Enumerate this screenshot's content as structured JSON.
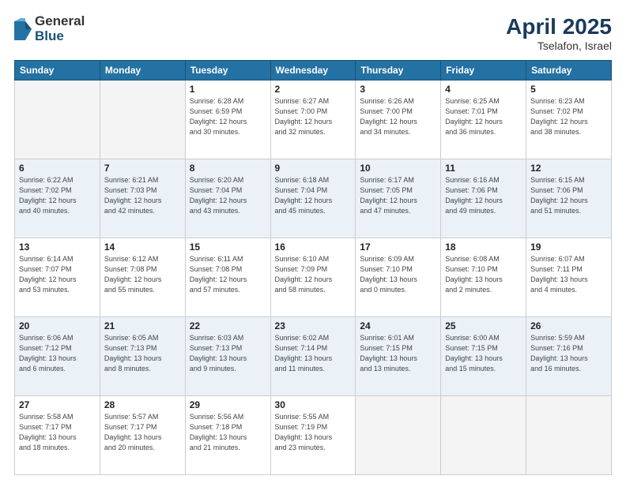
{
  "logo": {
    "general": "General",
    "blue": "Blue"
  },
  "header": {
    "month": "April 2025",
    "location": "Tselafon, Israel"
  },
  "days_of_week": [
    "Sunday",
    "Monday",
    "Tuesday",
    "Wednesday",
    "Thursday",
    "Friday",
    "Saturday"
  ],
  "weeks": [
    [
      {
        "day": "",
        "info": ""
      },
      {
        "day": "",
        "info": ""
      },
      {
        "day": "1",
        "info": "Sunrise: 6:28 AM\nSunset: 6:59 PM\nDaylight: 12 hours\nand 30 minutes."
      },
      {
        "day": "2",
        "info": "Sunrise: 6:27 AM\nSunset: 7:00 PM\nDaylight: 12 hours\nand 32 minutes."
      },
      {
        "day": "3",
        "info": "Sunrise: 6:26 AM\nSunset: 7:00 PM\nDaylight: 12 hours\nand 34 minutes."
      },
      {
        "day": "4",
        "info": "Sunrise: 6:25 AM\nSunset: 7:01 PM\nDaylight: 12 hours\nand 36 minutes."
      },
      {
        "day": "5",
        "info": "Sunrise: 6:23 AM\nSunset: 7:02 PM\nDaylight: 12 hours\nand 38 minutes."
      }
    ],
    [
      {
        "day": "6",
        "info": "Sunrise: 6:22 AM\nSunset: 7:02 PM\nDaylight: 12 hours\nand 40 minutes."
      },
      {
        "day": "7",
        "info": "Sunrise: 6:21 AM\nSunset: 7:03 PM\nDaylight: 12 hours\nand 42 minutes."
      },
      {
        "day": "8",
        "info": "Sunrise: 6:20 AM\nSunset: 7:04 PM\nDaylight: 12 hours\nand 43 minutes."
      },
      {
        "day": "9",
        "info": "Sunrise: 6:18 AM\nSunset: 7:04 PM\nDaylight: 12 hours\nand 45 minutes."
      },
      {
        "day": "10",
        "info": "Sunrise: 6:17 AM\nSunset: 7:05 PM\nDaylight: 12 hours\nand 47 minutes."
      },
      {
        "day": "11",
        "info": "Sunrise: 6:16 AM\nSunset: 7:06 PM\nDaylight: 12 hours\nand 49 minutes."
      },
      {
        "day": "12",
        "info": "Sunrise: 6:15 AM\nSunset: 7:06 PM\nDaylight: 12 hours\nand 51 minutes."
      }
    ],
    [
      {
        "day": "13",
        "info": "Sunrise: 6:14 AM\nSunset: 7:07 PM\nDaylight: 12 hours\nand 53 minutes."
      },
      {
        "day": "14",
        "info": "Sunrise: 6:12 AM\nSunset: 7:08 PM\nDaylight: 12 hours\nand 55 minutes."
      },
      {
        "day": "15",
        "info": "Sunrise: 6:11 AM\nSunset: 7:08 PM\nDaylight: 12 hours\nand 57 minutes."
      },
      {
        "day": "16",
        "info": "Sunrise: 6:10 AM\nSunset: 7:09 PM\nDaylight: 12 hours\nand 58 minutes."
      },
      {
        "day": "17",
        "info": "Sunrise: 6:09 AM\nSunset: 7:10 PM\nDaylight: 13 hours\nand 0 minutes."
      },
      {
        "day": "18",
        "info": "Sunrise: 6:08 AM\nSunset: 7:10 PM\nDaylight: 13 hours\nand 2 minutes."
      },
      {
        "day": "19",
        "info": "Sunrise: 6:07 AM\nSunset: 7:11 PM\nDaylight: 13 hours\nand 4 minutes."
      }
    ],
    [
      {
        "day": "20",
        "info": "Sunrise: 6:06 AM\nSunset: 7:12 PM\nDaylight: 13 hours\nand 6 minutes."
      },
      {
        "day": "21",
        "info": "Sunrise: 6:05 AM\nSunset: 7:13 PM\nDaylight: 13 hours\nand 8 minutes."
      },
      {
        "day": "22",
        "info": "Sunrise: 6:03 AM\nSunset: 7:13 PM\nDaylight: 13 hours\nand 9 minutes."
      },
      {
        "day": "23",
        "info": "Sunrise: 6:02 AM\nSunset: 7:14 PM\nDaylight: 13 hours\nand 11 minutes."
      },
      {
        "day": "24",
        "info": "Sunrise: 6:01 AM\nSunset: 7:15 PM\nDaylight: 13 hours\nand 13 minutes."
      },
      {
        "day": "25",
        "info": "Sunrise: 6:00 AM\nSunset: 7:15 PM\nDaylight: 13 hours\nand 15 minutes."
      },
      {
        "day": "26",
        "info": "Sunrise: 5:59 AM\nSunset: 7:16 PM\nDaylight: 13 hours\nand 16 minutes."
      }
    ],
    [
      {
        "day": "27",
        "info": "Sunrise: 5:58 AM\nSunset: 7:17 PM\nDaylight: 13 hours\nand 18 minutes."
      },
      {
        "day": "28",
        "info": "Sunrise: 5:57 AM\nSunset: 7:17 PM\nDaylight: 13 hours\nand 20 minutes."
      },
      {
        "day": "29",
        "info": "Sunrise: 5:56 AM\nSunset: 7:18 PM\nDaylight: 13 hours\nand 21 minutes."
      },
      {
        "day": "30",
        "info": "Sunrise: 5:55 AM\nSunset: 7:19 PM\nDaylight: 13 hours\nand 23 minutes."
      },
      {
        "day": "",
        "info": ""
      },
      {
        "day": "",
        "info": ""
      },
      {
        "day": "",
        "info": ""
      }
    ]
  ]
}
